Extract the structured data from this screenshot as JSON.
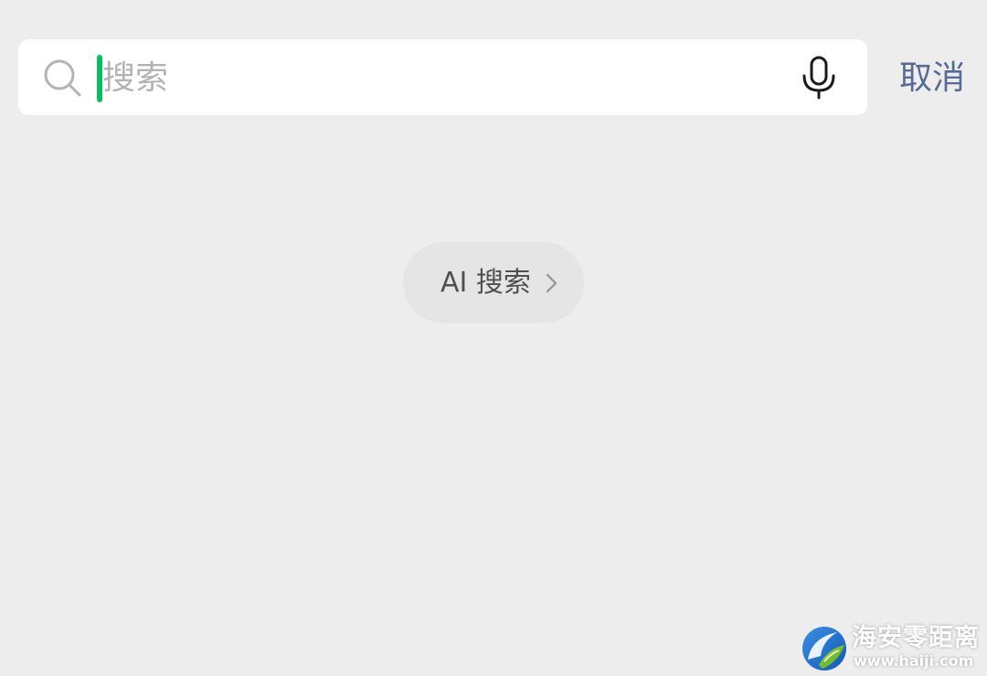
{
  "search": {
    "value": "",
    "placeholder": "搜索",
    "search_icon": "search-icon",
    "mic_icon": "mic-icon",
    "cancel_label": "取消"
  },
  "ai_search": {
    "label": "AI 搜索",
    "chevron_icon": "chevron-right-icon"
  },
  "watermark": {
    "name": "海安零距离",
    "url": "www.haiji.com"
  },
  "colors": {
    "background": "#ededed",
    "search_bar": "#ffffff",
    "cursor": "#07c160",
    "cancel_text": "#586b95",
    "ai_search_pill": "#e5e5e5"
  }
}
